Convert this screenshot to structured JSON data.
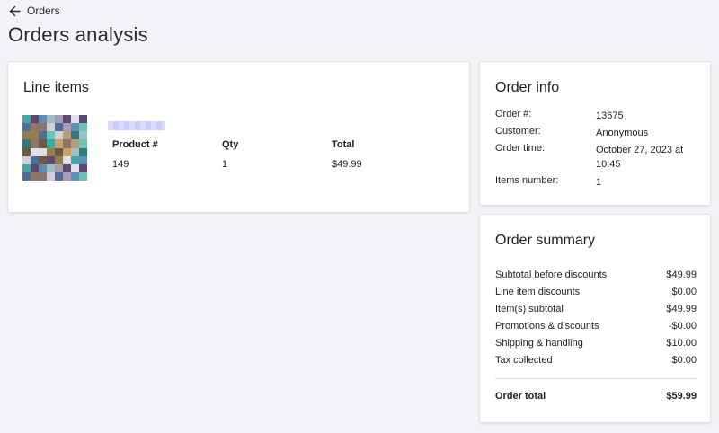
{
  "nav": {
    "back_label": "Orders"
  },
  "page": {
    "title": "Orders analysis"
  },
  "line_items": {
    "heading": "Line items",
    "columns": [
      "Product #",
      "Qty",
      "Total"
    ],
    "rows": [
      {
        "product": "149",
        "qty": "1",
        "total": "$49.99"
      }
    ]
  },
  "order_info": {
    "heading": "Order info",
    "fields": [
      {
        "label": "Order #:",
        "value": "13675"
      },
      {
        "label": "Customer:",
        "value": "Anonymous"
      },
      {
        "label": "Order time:",
        "value": "October 27, 2023 at 10:45"
      },
      {
        "label": "Items number:",
        "value": "1"
      }
    ]
  },
  "order_summary": {
    "heading": "Order summary",
    "rows": [
      {
        "label": "Subtotal before discounts",
        "value": "$49.99"
      },
      {
        "label": "Line item discounts",
        "value": "$0.00"
      },
      {
        "label": "Item(s) subtotal",
        "value": "$49.99"
      },
      {
        "label": "Promotions & discounts",
        "value": "-$0.00"
      },
      {
        "label": "Shipping & handling",
        "value": "$10.00"
      },
      {
        "label": "Tax collected",
        "value": "$0.00"
      }
    ],
    "total": {
      "label": "Order total",
      "value": "$59.99"
    }
  }
}
